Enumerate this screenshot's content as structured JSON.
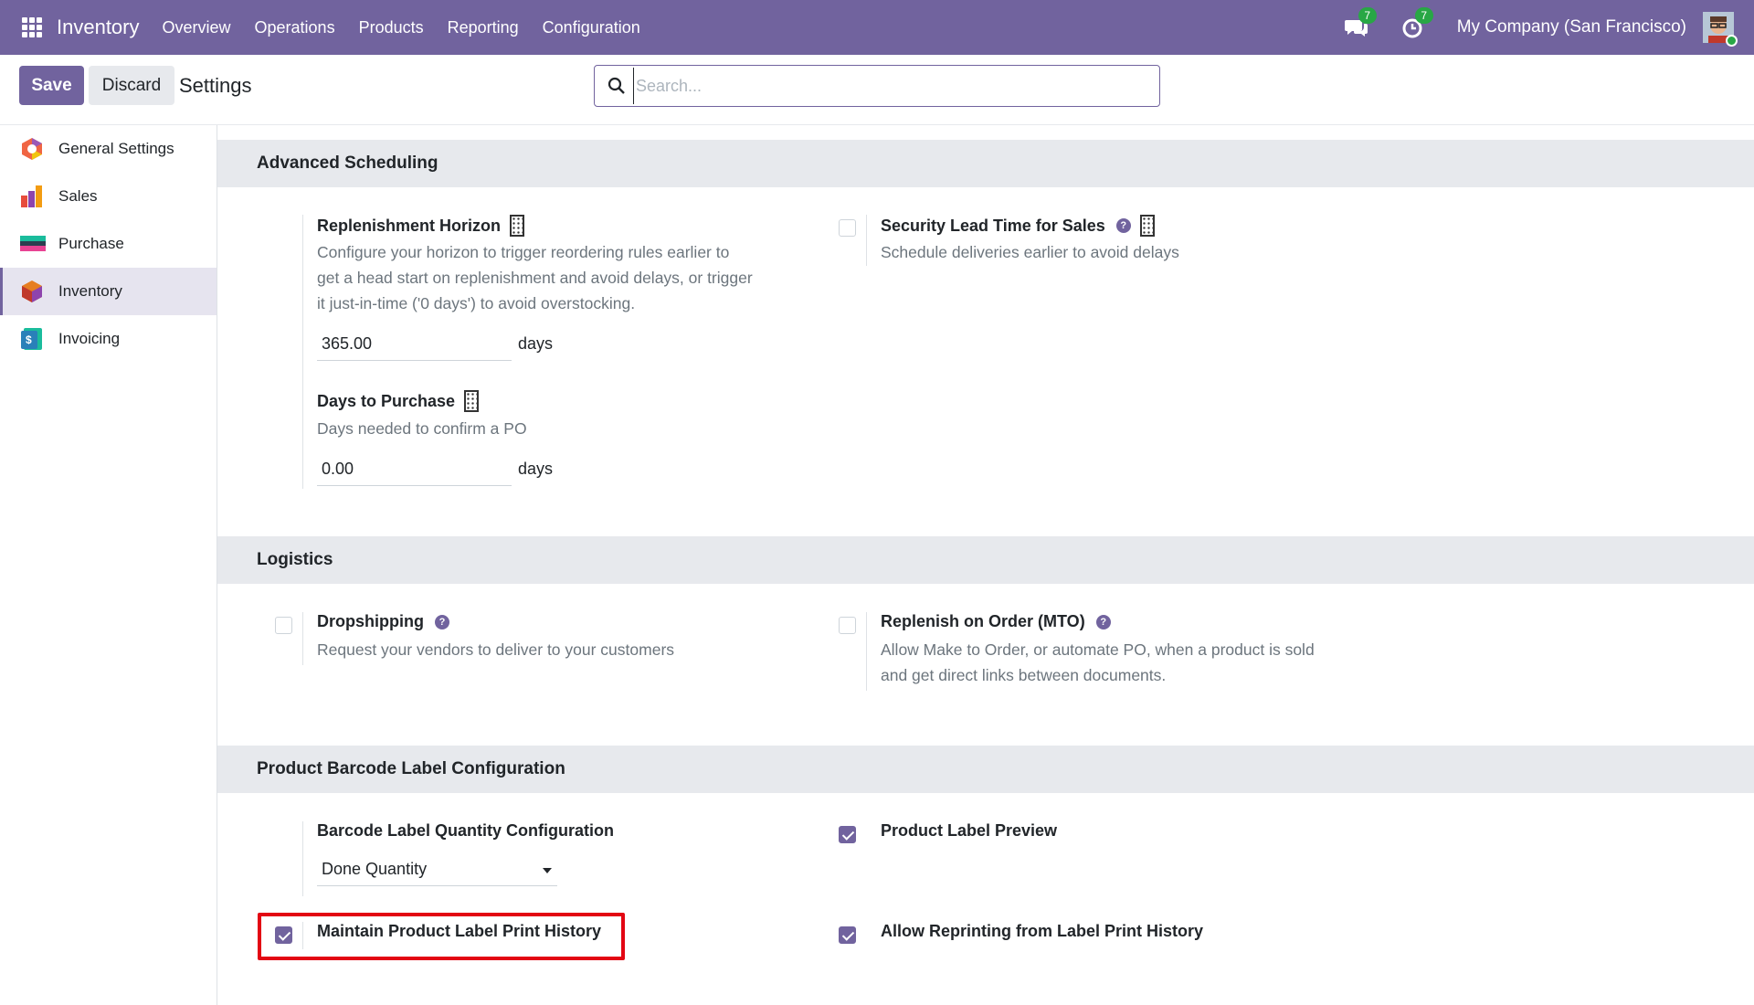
{
  "topbar": {
    "app_name": "Inventory",
    "menu": [
      "Overview",
      "Operations",
      "Products",
      "Reporting",
      "Configuration"
    ],
    "messages_count": "7",
    "activities_count": "7",
    "company": "My Company (San Francisco)"
  },
  "control": {
    "save_label": "Save",
    "discard_label": "Discard",
    "title": "Settings",
    "search_placeholder": "Search..."
  },
  "sidebar": {
    "items": [
      {
        "label": "General Settings",
        "icon": "general-settings-icon"
      },
      {
        "label": "Sales",
        "icon": "sales-icon"
      },
      {
        "label": "Purchase",
        "icon": "purchase-icon"
      },
      {
        "label": "Inventory",
        "icon": "inventory-icon",
        "active": true
      },
      {
        "label": "Invoicing",
        "icon": "invoicing-icon"
      }
    ]
  },
  "sections": {
    "advanced_scheduling": {
      "title": "Advanced Scheduling",
      "replenishment_horizon": {
        "label": "Replenishment Horizon",
        "desc_line1": "Configure your horizon to trigger reordering rules earlier to",
        "desc_line2": "get a head start on replenishment and avoid delays, or trigger",
        "desc_line3": "it just-in-time ('0 days') to avoid overstocking.",
        "value": "365.00",
        "unit": "days"
      },
      "security_lead_time": {
        "label": "Security Lead Time for Sales",
        "desc": "Schedule deliveries earlier to avoid delays",
        "checked": false
      },
      "days_to_purchase": {
        "label": "Days to Purchase",
        "desc": "Days needed to confirm a PO",
        "value": "0.00",
        "unit": "days"
      }
    },
    "logistics": {
      "title": "Logistics",
      "dropshipping": {
        "label": "Dropshipping",
        "desc": "Request your vendors to deliver to your customers",
        "checked": false
      },
      "mto": {
        "label": "Replenish on Order (MTO)",
        "desc_line1": "Allow Make to Order, or automate PO, when a product is sold",
        "desc_line2": "and get direct links between documents.",
        "checked": false
      }
    },
    "barcode_label": {
      "title": "Product Barcode Label Configuration",
      "qty_config": {
        "label": "Barcode Label Quantity Configuration",
        "selected": "Done Quantity"
      },
      "label_preview": {
        "label": "Product Label Preview",
        "checked": true
      },
      "print_history": {
        "label": "Maintain Product Label Print History",
        "checked": true
      },
      "reprint": {
        "label": "Allow Reprinting from Label Print History",
        "checked": true
      }
    }
  },
  "colors": {
    "brand": "#71639e",
    "badge": "#28a745",
    "highlight": "#e30613"
  }
}
